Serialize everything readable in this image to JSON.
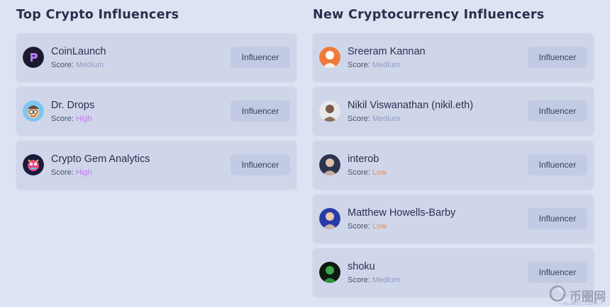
{
  "left": {
    "title": "Top Crypto Influencers",
    "items": [
      {
        "name": "CoinLaunch",
        "score_label": "Score:",
        "score_value": "Medium",
        "level": "medium",
        "button": "Influencer",
        "avatar_icon": "coinlaunch-logo-icon",
        "avatar_color": "#1b1b2f",
        "avatar_accent": "#b07cf0"
      },
      {
        "name": "Dr. Drops",
        "score_label": "Score:",
        "score_value": "High",
        "level": "high",
        "button": "Influencer",
        "avatar_icon": "cartoon-face-icon",
        "avatar_color": "#7cc6f0",
        "avatar_accent": "#f2c08a"
      },
      {
        "name": "Crypto Gem Analytics",
        "score_label": "Score:",
        "score_value": "High",
        "level": "high",
        "button": "Influencer",
        "avatar_icon": "gem-character-icon",
        "avatar_color": "#1a1a3a",
        "avatar_accent": "#e84a8a"
      }
    ]
  },
  "right": {
    "title": "New Cryptocurrency Influencers",
    "items": [
      {
        "name": "Sreeram Kannan",
        "score_label": "Score:",
        "score_value": "Medium",
        "level": "medium",
        "button": "Influencer",
        "avatar_icon": "user-photo-icon",
        "avatar_color": "#f07a3a",
        "avatar_accent": "#ffffff"
      },
      {
        "name": "Nikil Viswanathan (nikil.eth)",
        "score_label": "Score:",
        "score_value": "Medium",
        "level": "medium",
        "button": "Influencer",
        "avatar_icon": "user-photo-icon",
        "avatar_color": "#e8e8ea",
        "avatar_accent": "#7a5a48"
      },
      {
        "name": "interob",
        "score_label": "Score:",
        "score_value": "Low",
        "level": "low",
        "button": "Influencer",
        "avatar_icon": "user-photo-icon",
        "avatar_color": "#2c3450",
        "avatar_accent": "#e0c0a8"
      },
      {
        "name": "Matthew Howells-Barby",
        "score_label": "Score:",
        "score_value": "Low",
        "level": "low",
        "button": "Influencer",
        "avatar_icon": "user-photo-icon",
        "avatar_color": "#2a3aa8",
        "avatar_accent": "#e8c8b0"
      },
      {
        "name": "shoku",
        "score_label": "Score:",
        "score_value": "Medium",
        "level": "medium",
        "button": "Influencer",
        "avatar_icon": "user-photo-icon",
        "avatar_color": "#0e1a10",
        "avatar_accent": "#3aa84a"
      }
    ]
  },
  "watermark": {
    "text": "币圈网",
    "sub": "—ALIBTC.COM—"
  }
}
